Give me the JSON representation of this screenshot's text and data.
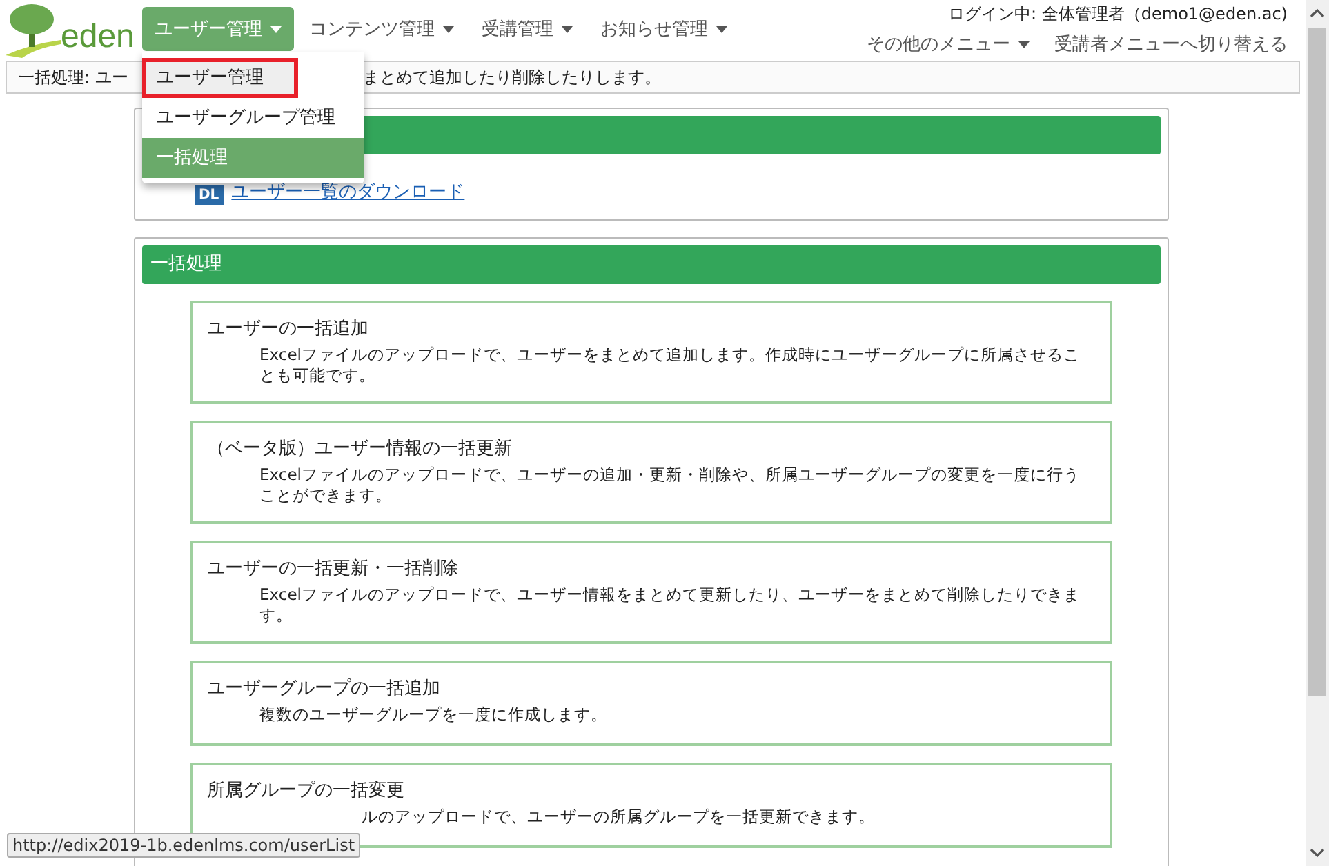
{
  "logo": {
    "text": "eden"
  },
  "nav": [
    {
      "label": "ユーザー管理",
      "selected": true
    },
    {
      "label": "コンテンツ管理",
      "selected": false
    },
    {
      "label": "受講管理",
      "selected": false
    },
    {
      "label": "お知らせ管理",
      "selected": false
    }
  ],
  "login_status": "ログイン中: 全体管理者（demo1@eden.ac)",
  "secondary_nav": [
    {
      "label": "その他のメニュー",
      "dropdown": true
    },
    {
      "label": "受講者メニューへ切り替える",
      "dropdown": false
    }
  ],
  "dropdown": [
    {
      "label": "ユーザー管理",
      "selected": false,
      "outlined": true
    },
    {
      "label": "ユーザーグループ管理",
      "selected": false,
      "outlined": false
    },
    {
      "label": "一括処理",
      "selected": true,
      "outlined": false
    }
  ],
  "info_bar": {
    "before": "一括処理: ユー",
    "after": "まとめて追加したり削除したりします。"
  },
  "download_panel": {
    "badge": "DL",
    "link": "ユーザー一覧のダウンロード"
  },
  "batch_panel": {
    "title": "一括処理",
    "items": [
      {
        "title": "ユーザーの一括追加",
        "description": "Excelファイルのアップロードで、ユーザーをまとめて追加します。作成時にユーザーグループに所属させることも可能です。",
        "covered_start": false
      },
      {
        "title": "（ベータ版）ユーザー情報の一括更新",
        "description": "Excelファイルのアップロードで、ユーザーの追加・更新・削除や、所属ユーザーグループの変更を一度に行うことができます。",
        "covered_start": false
      },
      {
        "title": "ユーザーの一括更新・一括削除",
        "description": "Excelファイルのアップロードで、ユーザー情報をまとめて更新したり、ユーザーをまとめて削除したりできます。",
        "covered_start": false
      },
      {
        "title": "ユーザーグループの一括追加",
        "description": "複数のユーザーグループを一度に作成します。",
        "covered_start": false
      },
      {
        "title": "所属グループの一括変更",
        "description": "ルのアップロードで、ユーザーの所属グループを一括更新できます。",
        "covered_start": true
      }
    ]
  },
  "status_url": "http://edix2019-1b.edenlms.com/userList"
}
